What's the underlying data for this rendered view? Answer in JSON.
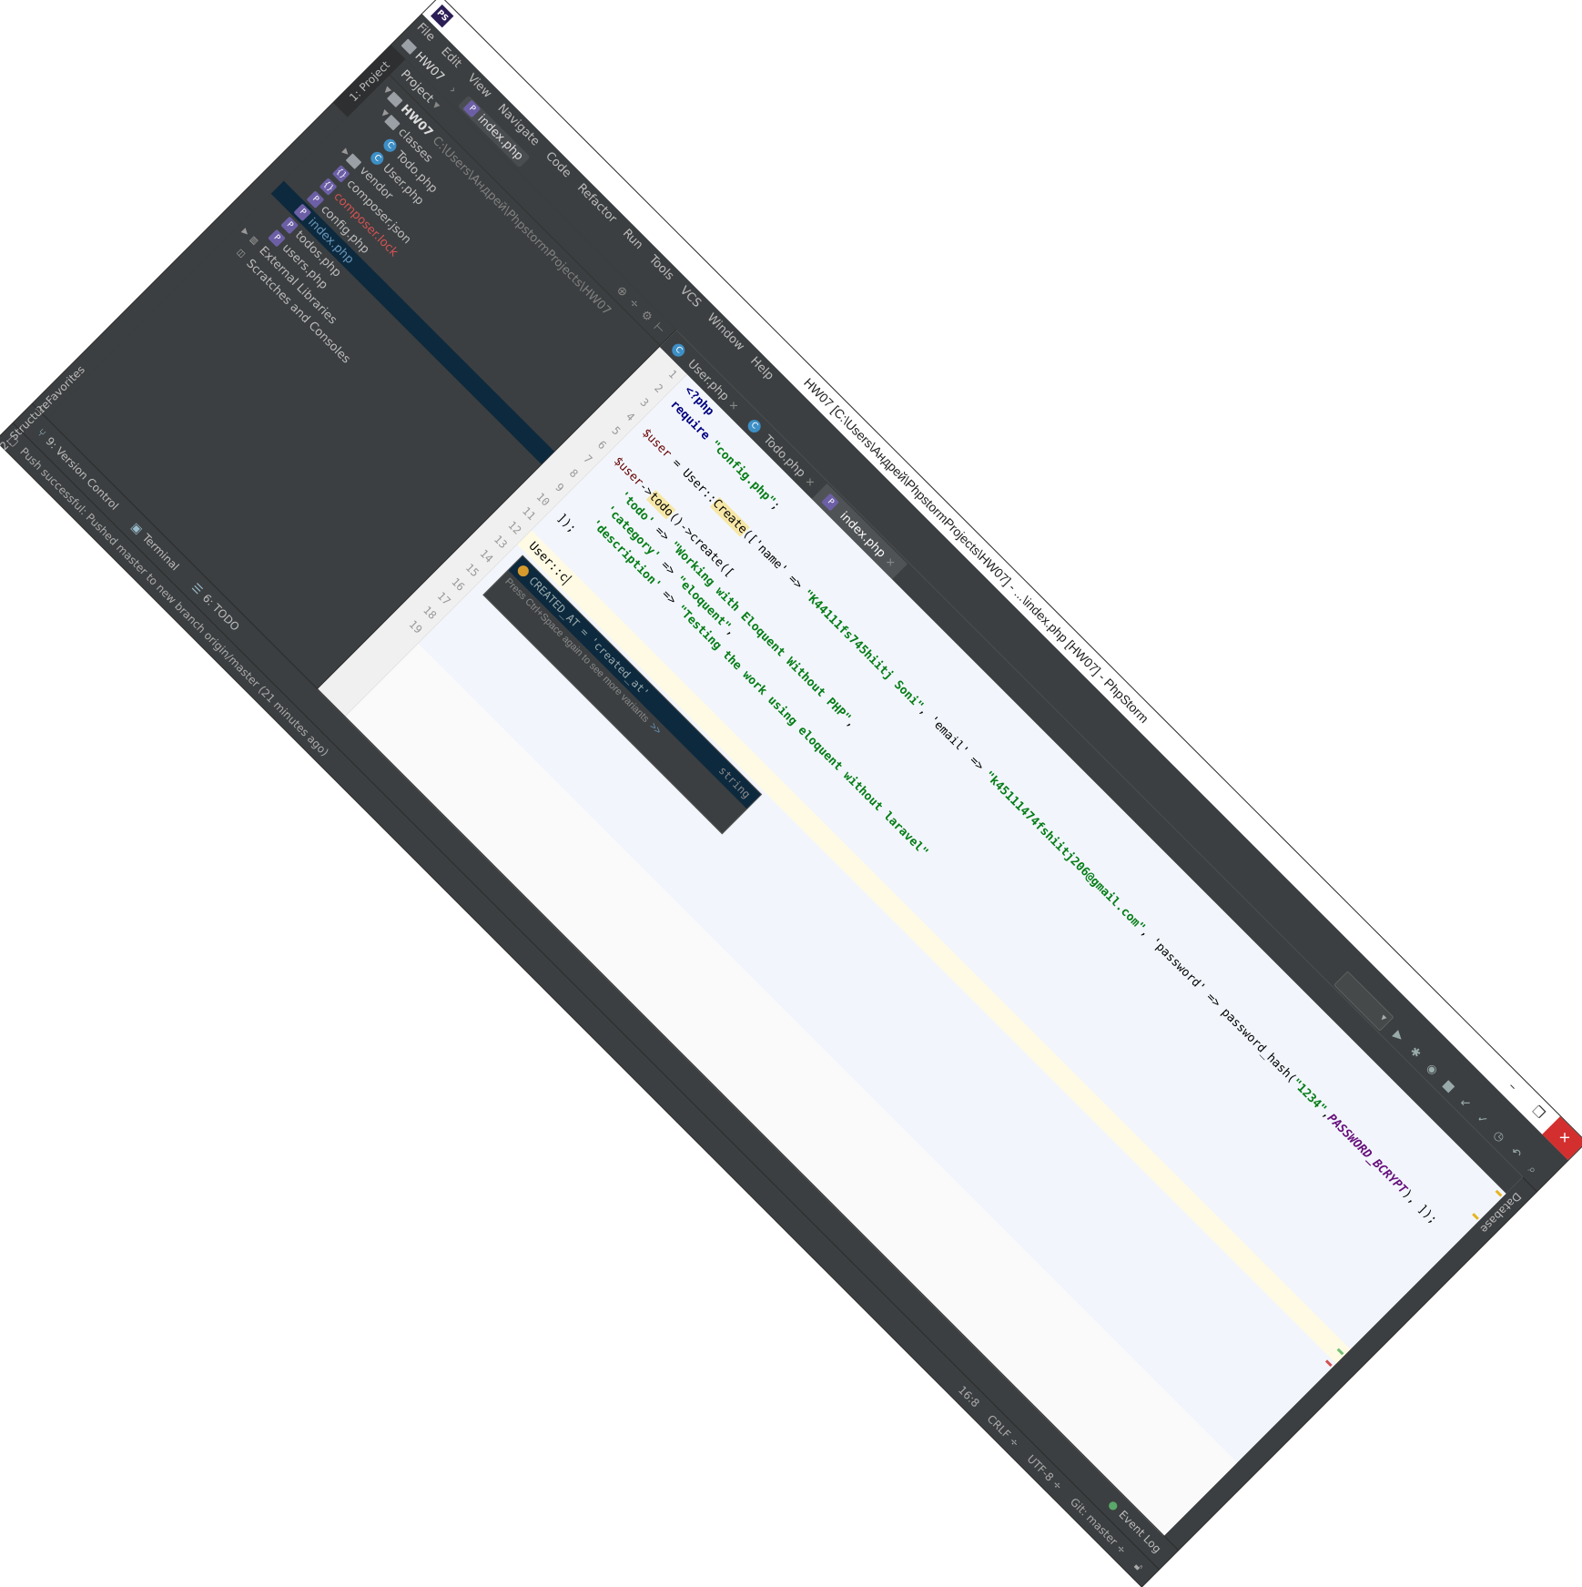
{
  "window": {
    "title": "HW07 [C:\\Users\\Андрей\\PhpstormProjects\\HW07] - ...\\index.php [HW07] - PhpStorm",
    "app_icon": "PS",
    "minimize": "–",
    "restore": "❐",
    "close": "✕"
  },
  "menu": [
    "File",
    "Edit",
    "View",
    "Navigate",
    "Code",
    "Refactor",
    "Run",
    "Tools",
    "VCS",
    "Window",
    "Help"
  ],
  "navbar": {
    "project": "HW07",
    "file": "index.php"
  },
  "left_tabs": {
    "project": "1: Project",
    "structure": "2: Structure",
    "favorites": "2: Favorites"
  },
  "right_tabs": {
    "database": "Database"
  },
  "project_panel": {
    "title": "Project",
    "tree": [
      {
        "label": "HW07",
        "hint": "C:\\Users\\Андрей\\PhpstormProjects\\HW07"
      },
      {
        "label": "classes"
      },
      {
        "label": "Todo.php"
      },
      {
        "label": "User.php"
      },
      {
        "label": "vendor"
      },
      {
        "label": "composer.json"
      },
      {
        "label": "composer.lock"
      },
      {
        "label": "config.php"
      },
      {
        "label": "index.php"
      },
      {
        "label": "todos.php"
      },
      {
        "label": "users.php"
      },
      {
        "label": "External Libraries"
      },
      {
        "label": "Scratches and Consoles"
      }
    ]
  },
  "editor_tabs": [
    "User.php",
    "Todo.php",
    "index.php"
  ],
  "code": {
    "line_numbers": [
      "1",
      "2",
      "3",
      "4",
      "5",
      "6",
      "7",
      "8",
      "9",
      "10",
      "11",
      "12",
      "13",
      "14",
      "15",
      "16",
      "17",
      "18",
      "19"
    ],
    "l1": "<?php",
    "l2_kw": "require",
    "l2_str": "\"config.php\"",
    "l2_end": ";",
    "l4_var": "$user",
    "l4_a": " = User::",
    "l4_hl": "Create",
    "l4_b": "(['name' => ",
    "l4_s1": "\"K44111fs745hiitj Soni\"",
    "l4_c": ", 'email' => ",
    "l4_s2": "\"k45111474fshiitj206@gmail.com\"",
    "l4_d": ", 'password' => password_hash(",
    "l4_s3": "\"1234\"",
    "l4_e": ",",
    "l4_const": "PASSWORD_BCRYPT",
    "l4_f": "), ]);",
    "l6_var": "$user",
    "l6_a": "->",
    "l6_hl": "todo",
    "l6_b": "()->create([",
    "l7_key": "'todo'",
    "l7_arrow": " => ",
    "l7_val": "\"Working with Eloquent Without PHP\"",
    "l7_end": ",",
    "l8_key": "'category'",
    "l8_arrow": " => ",
    "l8_val": "\"eloquent\"",
    "l8_end": ",",
    "l9_key": "'description'",
    "l9_arrow": " => ",
    "l9_val": "\"Testing the work using eloquent without laravel\"",
    "l10": "]);",
    "l12": "User::c"
  },
  "autocomplete": {
    "item": "CREATED_AT = 'created_at'",
    "type": "string",
    "hint": "Press Ctrl+Space again to see more variants",
    "more": ">>"
  },
  "bottom_tabs": [
    "9: Version Control",
    "Terminal",
    "6: TODO",
    "Event Log"
  ],
  "status": {
    "message": "Push successful: Pushed master to new branch origin/master (21 minutes ago)",
    "position": "16:8",
    "line_sep": "CRLF ÷",
    "encoding": "UTF-8 ÷",
    "git": "Git: master ÷"
  }
}
